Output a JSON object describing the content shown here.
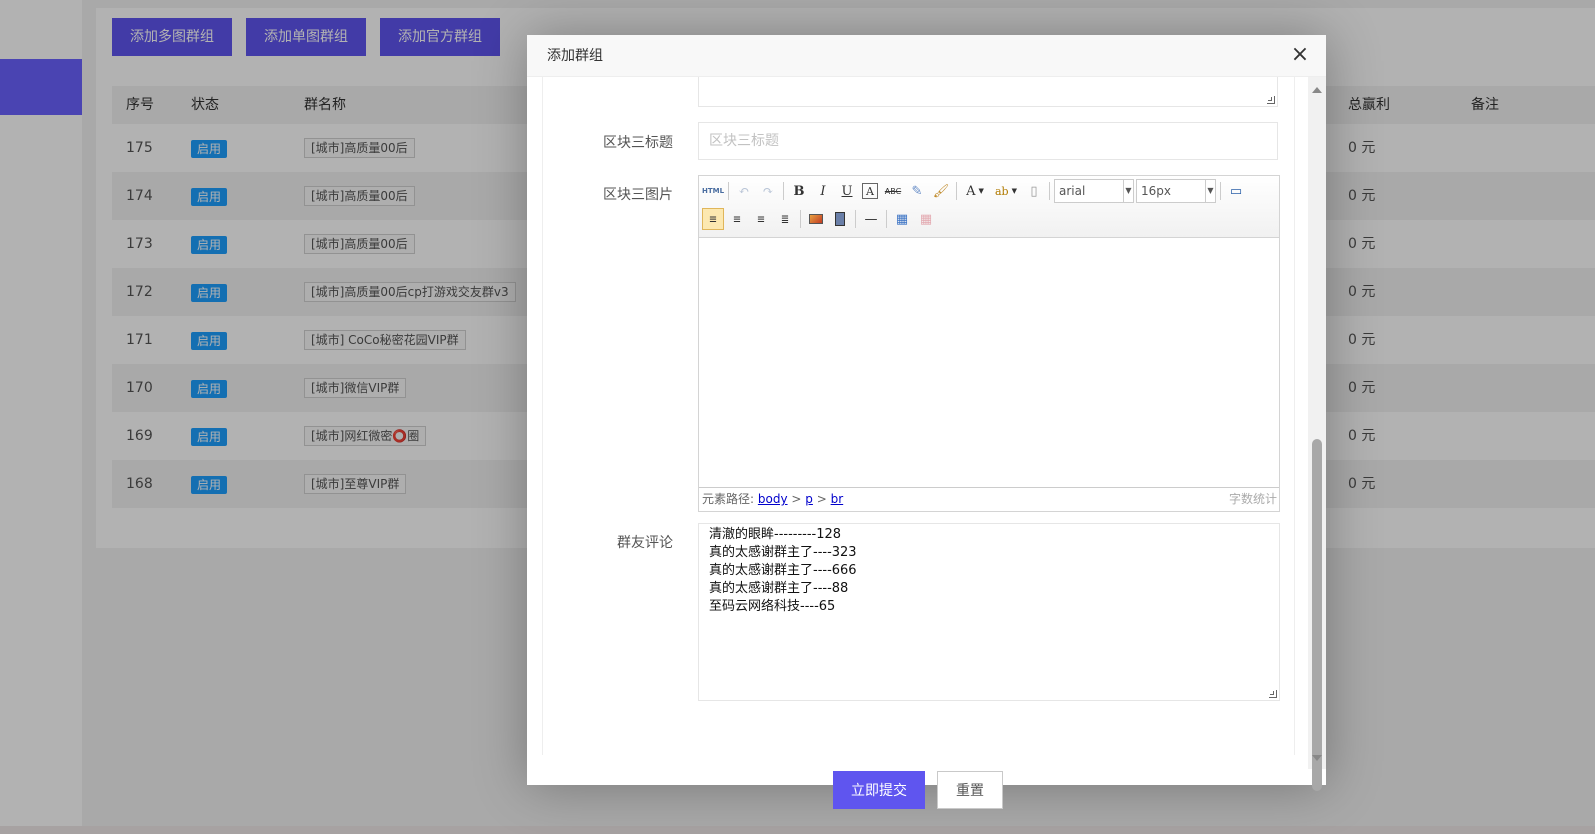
{
  "toolbar_buttons": {
    "add_multi": "添加多图群组",
    "add_single": "添加单图群组",
    "add_official": "添加官方群组"
  },
  "table": {
    "headers": {
      "seq": "序号",
      "status": "状态",
      "name": "群名称",
      "profit": "总赢利",
      "note": "备注"
    },
    "rows": [
      {
        "seq": "175",
        "status": "启用",
        "name": "[城市]高质量00后",
        "profit": "0 元"
      },
      {
        "seq": "174",
        "status": "启用",
        "name": "[城市]高质量00后",
        "profit": "0 元"
      },
      {
        "seq": "173",
        "status": "启用",
        "name": "[城市]高质量00后",
        "profit": "0 元"
      },
      {
        "seq": "172",
        "status": "启用",
        "name": "[城市]高质量00后cp打游戏交友群v3",
        "profit": "0 元"
      },
      {
        "seq": "171",
        "status": "启用",
        "name": "[城市] CoCo秘密花园VIP群",
        "profit": "0 元"
      },
      {
        "seq": "170",
        "status": "启用",
        "name": "[城市]微信VIP群",
        "profit": "0 元"
      },
      {
        "seq": "169",
        "status": "启用",
        "name": "[城市]网红微密⭕圈",
        "profit": "0 元"
      },
      {
        "seq": "168",
        "status": "启用",
        "name": "[城市]至尊VIP群",
        "profit": "0 元"
      }
    ]
  },
  "modal": {
    "title": "添加群组",
    "close_symbol": "×",
    "fields": {
      "block3_title_label": "区块三标题",
      "block3_title_placeholder": "区块三标题",
      "block3_image_label": "区块三图片",
      "comments_label": "群友评论"
    },
    "editor": {
      "html_label": "HTML",
      "font_family": "arial",
      "font_size": "16px",
      "path_label": "元素路径:",
      "path_body": "body",
      "path_p": "p",
      "path_br": "br",
      "path_sep": ">",
      "word_count": "字数统计"
    },
    "comments": [
      "清澈的眼眸---------128",
      "真的太感谢群主了----323",
      "真的太感谢群主了----666",
      "真的太感谢群主了----88",
      "至码云网络科技----65"
    ],
    "submit_label": "立即提交",
    "reset_label": "重置"
  },
  "colors": {
    "primary": "#5f55ef",
    "badge": "#1e9fff",
    "sidebar_active": "#6b62ff"
  }
}
